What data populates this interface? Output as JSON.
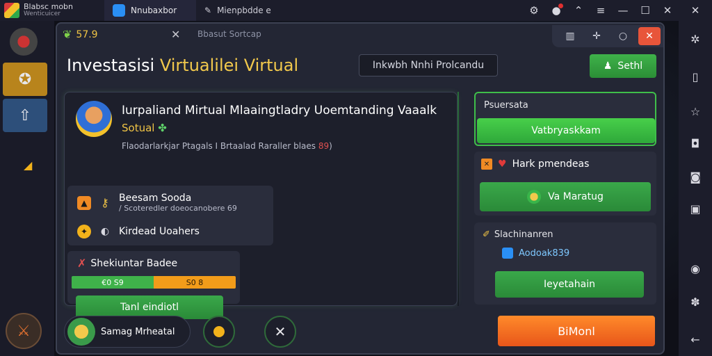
{
  "titlebar": {
    "app_name": "Blabsc mobn",
    "app_sub": "Wenticuicer",
    "tabs": [
      {
        "label": "Nnubaxbor"
      },
      {
        "label": "Mienpbdde  e"
      }
    ]
  },
  "dialog": {
    "coin_value": "57.9",
    "subtitle": "Bbasut Sortcap",
    "title_plain": "Investasisi ",
    "title_highlight": "Virtualilei",
    "title_tail": " Virtual",
    "search_text": "Inkwbh Nnhi  Prolcandu",
    "sell_label": "Sethl"
  },
  "hero": {
    "name": "Iurpaliand Mirtual Mlaaingtladry Uoemtanding Vaaalk",
    "sub": "Sotual",
    "sub_icon": "✤",
    "desc_main": "Flaodarlarkjar Ptagals I Brtaalad Raraller blaes",
    "desc_num": "89",
    "desc_tail": ")"
  },
  "stats": [
    {
      "main": "Beesam Sooda",
      "small": "/ Scoteredler doeocanobere 69"
    },
    {
      "main": "Kirdead Uoahers",
      "small": ""
    }
  ],
  "upgrade": {
    "title": "Shekiuntar Badee",
    "bar_left": "€0 S9",
    "bar_right": "S0 8",
    "progress": 0.5,
    "train_label": "Tanl eindiotl"
  },
  "side": {
    "card1_title": "Psuersata",
    "card1_btn": "Vatbryaskkam",
    "card2_title": "Hark pmendeas",
    "card2_btn": "Va Maratug",
    "card3_title": "Slachinanren",
    "card3_sub": "Aodoak839",
    "card3_btn": "Ieyetahain"
  },
  "bottom": {
    "hero_label": "Samag Mrheatal",
    "orange_btn": "BiMonl"
  },
  "colors": {
    "accent_green": "#3fb24a",
    "accent_orange": "#f28a24",
    "accent_gold": "#f2c94c",
    "close_red": "#e8553a"
  }
}
